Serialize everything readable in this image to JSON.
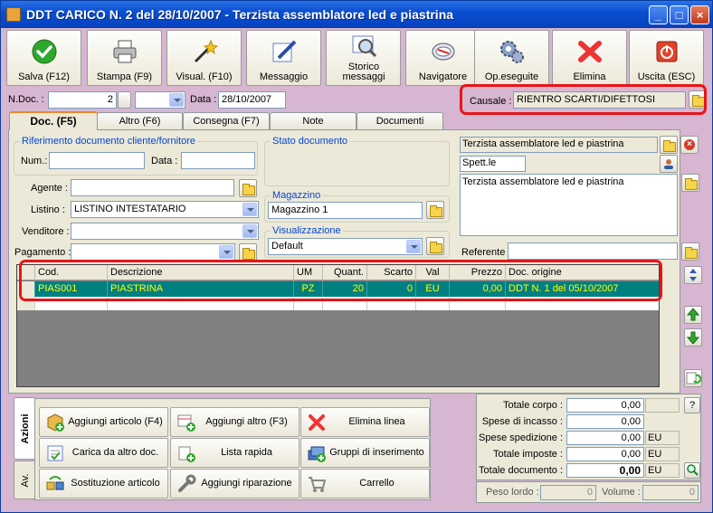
{
  "window": {
    "title": "DDT CARICO N.  2  del 28/10/2007 - Terzista assemblatore led e piastrina",
    "minimize_glyph": "_",
    "maximize_glyph": "□",
    "close_glyph": "×"
  },
  "toolbar": [
    {
      "id": "salva",
      "label": "Salva (F12)",
      "icon": "check-icon"
    },
    {
      "id": "stampa",
      "label": "Stampa (F9)",
      "icon": "printer-icon"
    },
    {
      "id": "visual",
      "label": "Visual. (F10)",
      "icon": "magic-wand-icon"
    },
    {
      "id": "messaggio",
      "label": "Messaggio",
      "icon": "pen-icon"
    },
    {
      "id": "storico",
      "label": "Storico messaggi",
      "icon": "magnifier-icon"
    },
    {
      "id": "navigatore",
      "label": "Navigatore",
      "icon": "compass-icon"
    },
    {
      "id": "opeseguite",
      "label": "Op.eseguite",
      "icon": "gears-icon"
    },
    {
      "id": "elimina",
      "label": "Elimina",
      "icon": "x-icon"
    },
    {
      "id": "uscita",
      "label": "Uscita (ESC)",
      "icon": "exit-icon"
    }
  ],
  "header": {
    "ndoc_label": "N.Doc. :",
    "ndoc_value": "2",
    "data_label": "Data :",
    "data_value": "28/10/2007",
    "causale_label": "Causale :",
    "causale_value": "RIENTRO SCARTI/DIFETTOSI"
  },
  "tabs": [
    {
      "label": "Doc. (F5)",
      "active": true
    },
    {
      "label": "Altro (F6)",
      "active": false
    },
    {
      "label": "Consegna (F7)",
      "active": false
    },
    {
      "label": "Note",
      "active": false
    },
    {
      "label": "Documenti",
      "active": false
    }
  ],
  "riferimento": {
    "title": "Riferimento documento cliente/fornitore",
    "num_label": "Num.:",
    "num_value": "",
    "data_label": "Data :",
    "data_value": ""
  },
  "form": {
    "agente_label": "Agente :",
    "agente_value": "",
    "listino_label": "Listino :",
    "listino_value": "LISTINO INTESTATARIO",
    "venditore_label": "Venditore :",
    "venditore_value": "",
    "pagamento_label": "Pagamento :",
    "pagamento_value": ""
  },
  "stato": {
    "title": "Stato documento"
  },
  "magazzino": {
    "title": "Magazzino",
    "value": "Magazzino 1"
  },
  "visualizzazione": {
    "title": "Visualizzazione",
    "value": "Default"
  },
  "intestatario": {
    "name": "Terzista assemblatore led e piastrina",
    "title": "Spett.le",
    "address": "Terzista assemblatore led e piastrina",
    "referente_label": "Referente",
    "referente_value": ""
  },
  "grid": {
    "columns": [
      "Cod.",
      "Descrizione",
      "UM",
      "Quant.",
      "Scarto",
      "Val",
      "Prezzo",
      "Doc. origine"
    ],
    "rows": [
      {
        "cod": "PIAS001",
        "descrizione": "PIASTRINA",
        "um": "PZ",
        "quant": "20",
        "scarto": "0",
        "val": "EU",
        "prezzo": "0,00",
        "origine": "DDT N. 1 del 05/10/2007"
      }
    ]
  },
  "side_tabs": {
    "azioni": "Azioni",
    "av": "Av."
  },
  "actions": [
    {
      "label": "Aggiungi articolo (F4)",
      "icon": "add-article-icon"
    },
    {
      "label": "Aggiungi altro (F3)",
      "icon": "add-other-icon"
    },
    {
      "label": "Elimina linea",
      "icon": "delete-line-icon"
    },
    {
      "label": "Carica da altro doc.",
      "icon": "load-doc-icon"
    },
    {
      "label": "Lista rapida",
      "icon": "quick-list-icon"
    },
    {
      "label": "Gruppi di inserimento",
      "icon": "groups-icon"
    },
    {
      "label": "Sostituzione articolo",
      "icon": "replace-icon"
    },
    {
      "label": "Aggiungi riparazione",
      "icon": "repair-icon"
    },
    {
      "label": "Carrello",
      "icon": "cart-icon"
    }
  ],
  "totals": {
    "totale_corpo_label": "Totale corpo :",
    "totale_corpo": "0,00",
    "help_label": "?",
    "spese_incasso_label": "Spese di incasso :",
    "spese_incasso": "0,00",
    "spese_spedizione_label": "Spese spedizione :",
    "spese_spedizione": "0,00",
    "spese_spedizione_unit": "EU",
    "totale_imposte_label": "Totale imposte :",
    "totale_imposte": "0,00",
    "totale_imposte_unit": "EU",
    "totale_documento_label": "Totale documento :",
    "totale_documento": "0,00",
    "totale_documento_unit": "EU",
    "peso_lordo_label": "Peso lordo :",
    "peso_lordo": "0",
    "volume_label": "Volume :",
    "volume": "0"
  },
  "colors": {
    "highlight": "#e8141a",
    "grid_row": "#008080",
    "grid_text": "#ffff00",
    "background": "#d6b6d1"
  }
}
